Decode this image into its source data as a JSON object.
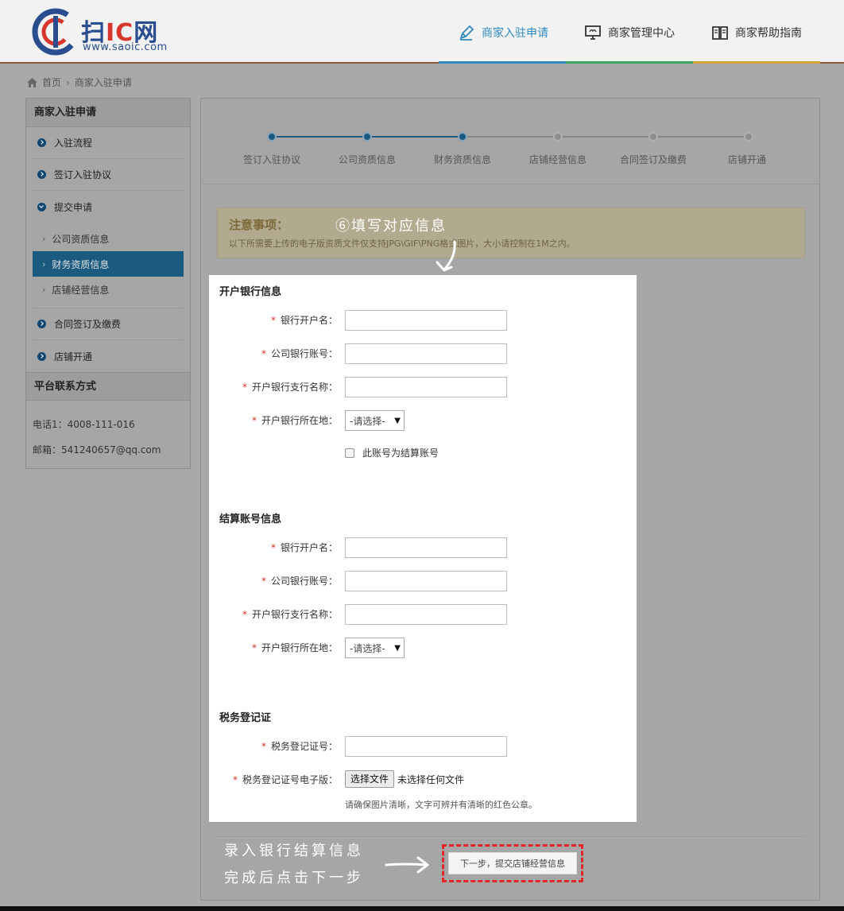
{
  "header": {
    "logo_text_main": "扫",
    "logo_text_ic": "IC",
    "logo_text_tail": "网",
    "logo_url": "www.saoic.com",
    "nav": [
      {
        "label": "商家入驻申请",
        "icon": "pen-icon",
        "active": true
      },
      {
        "label": "商家管理中心",
        "icon": "monitor-icon",
        "active": false
      },
      {
        "label": "商家帮助指南",
        "icon": "book-icon",
        "active": false
      }
    ]
  },
  "breadcrumb": {
    "home": "首页",
    "current": "商家入驻申请"
  },
  "sidebar": {
    "title": "商家入驻申请",
    "items": [
      {
        "label": "入驻流程"
      },
      {
        "label": "签订入驻协议"
      },
      {
        "label": "提交申请"
      }
    ],
    "subitems": [
      {
        "label": "公司资质信息"
      },
      {
        "label": "财务资质信息"
      },
      {
        "label": "店铺经营信息"
      }
    ],
    "items2": [
      {
        "label": "合同签订及缴费"
      },
      {
        "label": "店铺开通"
      }
    ],
    "contact_title": "平台联系方式",
    "phone": "电话1：4008-111-016",
    "email": "邮箱：541240657@qq.com"
  },
  "steps": [
    "签订入驻协议",
    "公司资质信息",
    "财务资质信息",
    "店铺经营信息",
    "合同签订及缴费",
    "店铺开通"
  ],
  "steps_completed": 3,
  "notice": {
    "title": "注意事项：",
    "text": "以下所需要上传的电子版资质文件仅支持JPG\\GIF\\PNG格式图片，大小请控制在1M之内。"
  },
  "annotation_top": "⑥填写对应信息",
  "form": {
    "bank_section": "开户银行信息",
    "settle_section": "结算账号信息",
    "tax_section": "税务登记证",
    "labels": {
      "account_name": "银行开户名：",
      "account_no": "公司银行账号：",
      "branch": "开户银行支行名称：",
      "location": "开户银行所在地："
    },
    "select_placeholder": "-请选择-",
    "same_account": "此账号为结算账号",
    "tax_no_label": "税务登记证号：",
    "tax_file_label": "税务登记证号电子版：",
    "file_button": "选择文件",
    "file_none": "未选择任何文件",
    "file_hint": "请确保图片清晰，文字可辨并有清晰的红色公章。"
  },
  "annotation_bottom": [
    "录入银行结算信息",
    "完成后点击下一步"
  ],
  "next_button": "下一步，提交店铺经营信息",
  "colors": {
    "accent": "#2e8ac0",
    "active_sidebar": "#1b5b80",
    "required": "#d8352c",
    "highlight": "#e3262a"
  }
}
